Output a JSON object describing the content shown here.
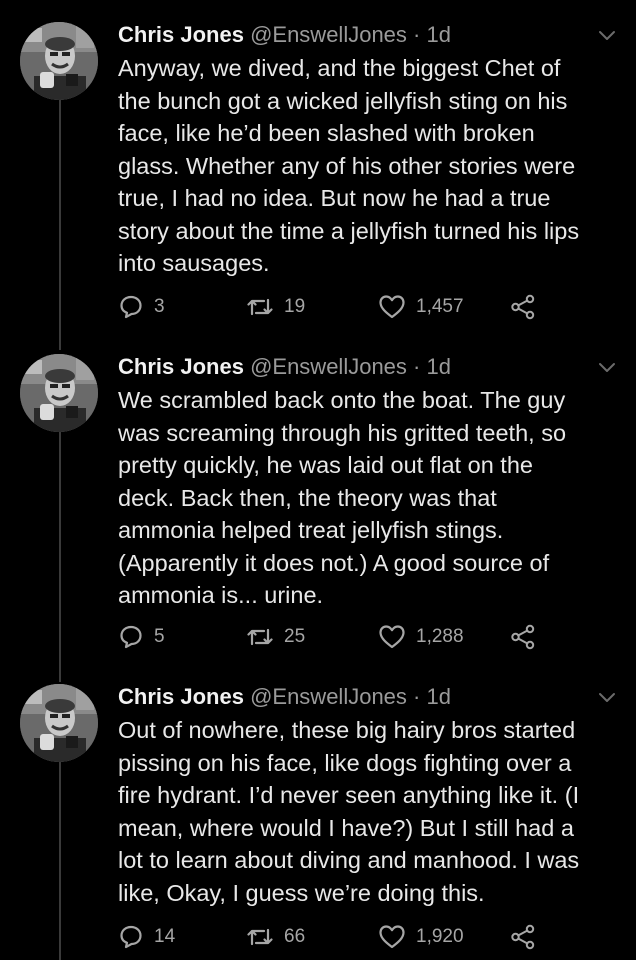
{
  "tweets": [
    {
      "name": "Chris Jones",
      "handle": "@EnswellJones",
      "separator": "·",
      "time": "1d",
      "text": "Anyway, we dived, and the biggest Chet of\nthe bunch got a wicked jellyfish sting on his\nface, like he’d been slashed with broken\nglass. Whether any of his other stories were\ntrue, I had no idea. But now he had a true\nstory about the time a jellyfish turned his lips\ninto sausages.",
      "replies": "3",
      "retweets": "19",
      "likes": "1,457"
    },
    {
      "name": "Chris Jones",
      "handle": "@EnswellJones",
      "separator": "·",
      "time": "1d",
      "text": "We scrambled back onto the boat. The guy\nwas screaming through his gritted teeth, so\npretty quickly, he was laid out flat on the\ndeck. Back then, the theory was that\nammonia helped treat jellyfish stings.\n(Apparently it does not.) A good source of\nammonia is... urine.",
      "replies": "5",
      "retweets": "25",
      "likes": "1,288"
    },
    {
      "name": "Chris Jones",
      "handle": "@EnswellJones",
      "separator": "·",
      "time": "1d",
      "text": "Out of nowhere, these big hairy bros started\npissing on his face, like dogs fighting over a\nfire hydrant. I’d never seen anything like it. (I\nmean, where would I have?) But I still had a\nlot to learn about diving and manhood. I was\nlike, Okay, I guess we’re doing this.",
      "replies": "14",
      "retweets": "66",
      "likes": "1,920"
    }
  ],
  "icons": {
    "avatar": "profile-photo",
    "more": "chevron-down-icon",
    "reply": "reply-icon",
    "retweet": "retweet-icon",
    "like": "heart-icon",
    "share": "share-icon"
  },
  "colors": {
    "background": "#000000",
    "text": "#e8e8e8",
    "muted": "#9a9a9a",
    "thread_line": "#3a3a3a"
  }
}
